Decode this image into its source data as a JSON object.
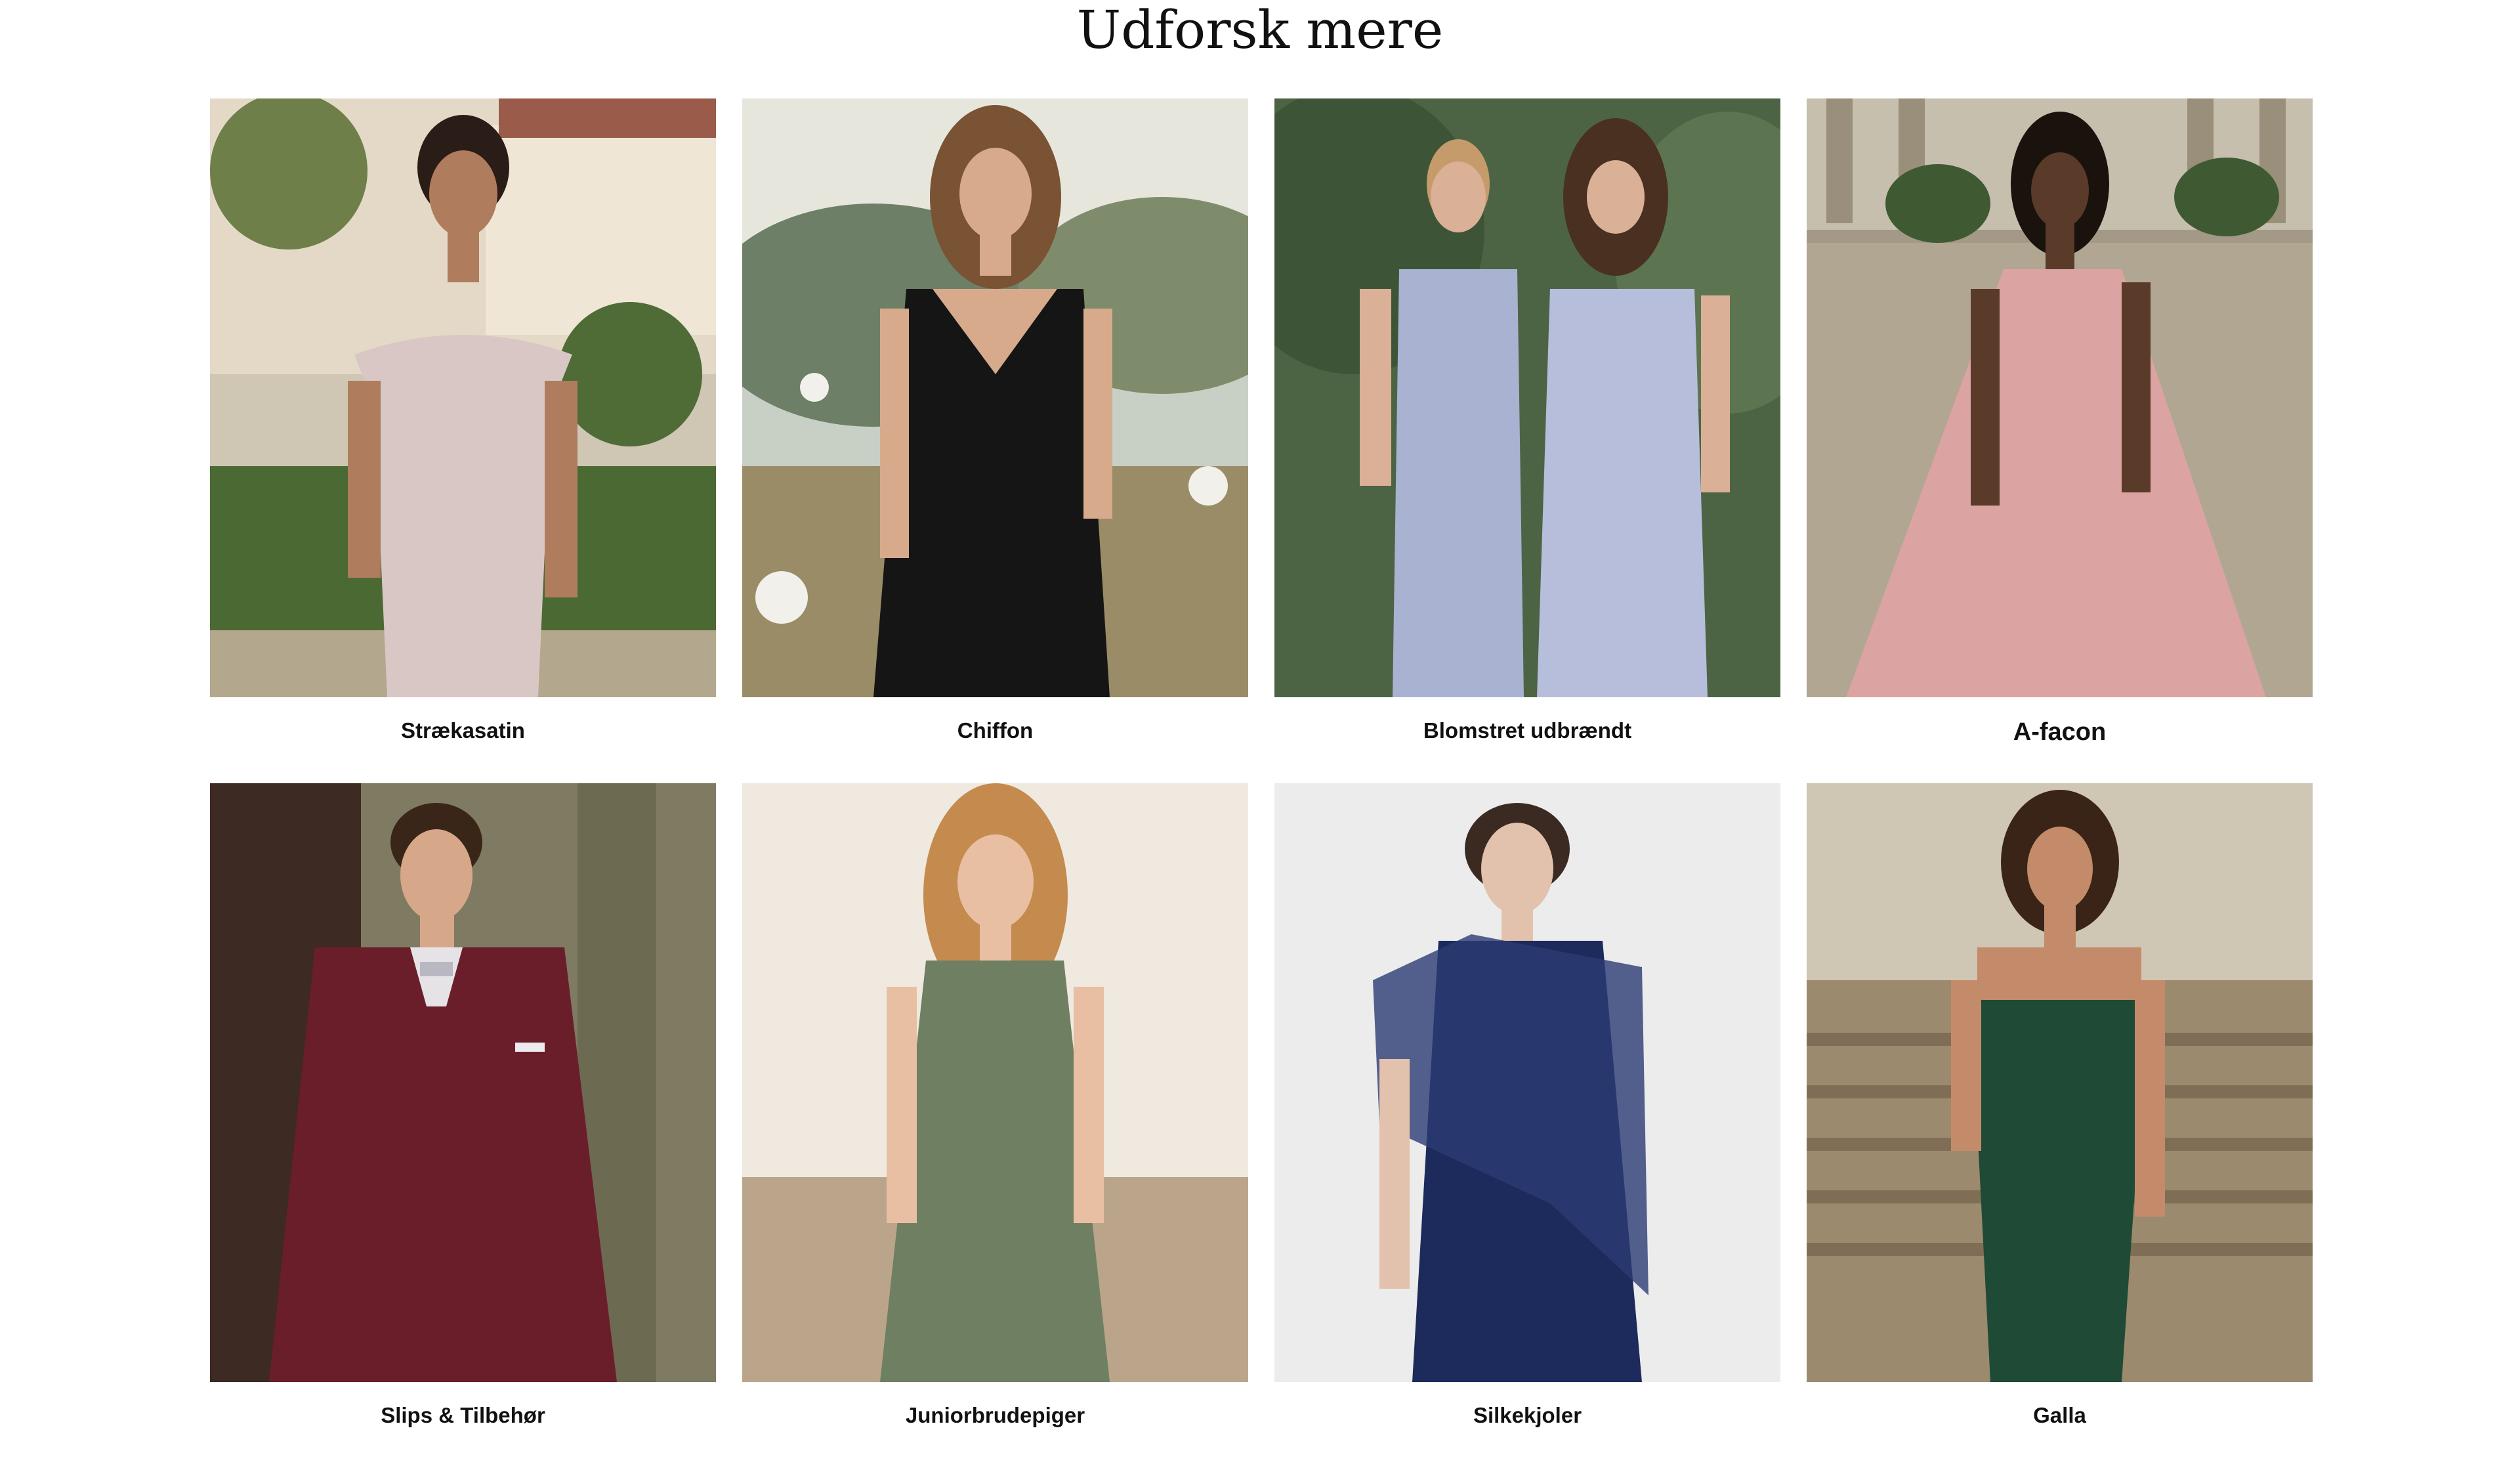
{
  "section": {
    "title": "Udforsk mere"
  },
  "tiles": [
    {
      "label": "Strækasatin",
      "image": "model-in-blush-satin-off-shoulder-gown",
      "colors": {
        "bg": "#b9a882",
        "garment": "#d8c7c4",
        "skin": "#b07c5e",
        "hair": "#2a1c16"
      }
    },
    {
      "label": "Chiffon",
      "image": "model-in-black-pleated-chiffon-gown",
      "colors": {
        "bg": "#8d9a83",
        "garment": "#151515",
        "skin": "#d8aa8c",
        "hair": "#7a5234"
      }
    },
    {
      "label": "Blomstret udbrændt",
      "image": "two-models-in-lavender-blue-gowns",
      "colors": {
        "bg": "#4c6444",
        "garment": "#a9b2d1",
        "skin": "#dab096",
        "hair": "#4a3020"
      }
    },
    {
      "label": "A-facon",
      "image": "model-in-dusty-pink-one-shoulder-gown",
      "colors": {
        "bg": "#a39986",
        "garment": "#dca3a3",
        "skin": "#5a3b2a",
        "hair": "#1a120d"
      }
    },
    {
      "label": "Slips & Tilbehør",
      "image": "man-in-burgundy-three-piece-suit",
      "colors": {
        "bg": "#7f7b62",
        "garment": "#6a1e2a",
        "skin": "#d7a78a",
        "hair": "#3a2618"
      }
    },
    {
      "label": "Juniorbrudepiger",
      "image": "junior-bridesmaid-in-sage-chiffon-dress",
      "colors": {
        "bg": "#e6ded2",
        "garment": "#6e7f62",
        "skin": "#e9bfa3",
        "hair": "#c48a4e"
      }
    },
    {
      "label": "Silkekjoler",
      "image": "model-in-navy-silk-dress-with-sheer-cape",
      "colors": {
        "bg": "#ececec",
        "garment": "#1c2a5c",
        "skin": "#e3c2ad",
        "hair": "#3b2a22"
      }
    },
    {
      "label": "Galla",
      "image": "model-in-emerald-beaded-strapless-gown",
      "colors": {
        "bg": "#9c8a6e",
        "garment": "#1e4a36",
        "skin": "#c48b6a",
        "hair": "#3a2418"
      }
    }
  ]
}
